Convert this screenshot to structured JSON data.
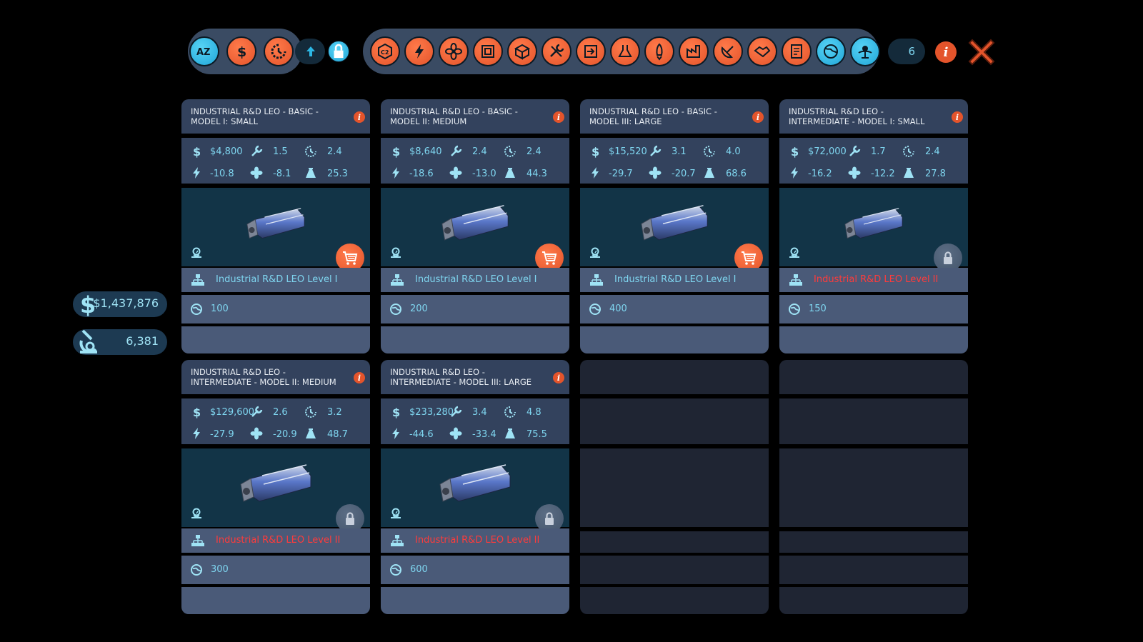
{
  "toolbar": {
    "sort_buttons": [
      "az-sort-icon",
      "dollar-icon",
      "build-time-icon"
    ],
    "sort_direction_icon": "arrow-up-icon",
    "lock_filter_icon": "lock-icon",
    "categories": [
      "co2-icon",
      "power-icon",
      "fan-icon",
      "habitat-icon",
      "storage-icon",
      "tools-icon",
      "docking-icon",
      "lab-icon",
      "thruster-icon",
      "factory-icon",
      "dish-icon",
      "handshake-icon",
      "document-icon",
      "globe-icon",
      "research-leo-icon"
    ],
    "result_count": "6",
    "info_icon": "info-icon",
    "close_icon": "close-icon"
  },
  "funds": {
    "money": "$1,437,876",
    "research": "6,381"
  },
  "colors": {
    "accent_orange": "#e4542b",
    "accent_blue": "#2cb7e4",
    "locked_red": "#ff3b3b"
  },
  "cards": [
    {
      "title": "INDUSTRIAL R&D LEO - BASIC - MODEL I: SMALL",
      "price": "$4,800",
      "build": "1.5",
      "time": "2.4",
      "power": "-10.8",
      "cooling": "-8.1",
      "mass": "25.3",
      "requirement": "Industrial R&D LEO Level I",
      "req_met": true,
      "research": "100",
      "action": "buy"
    },
    {
      "title": "INDUSTRIAL R&D LEO - BASIC - MODEL II: MEDIUM",
      "price": "$8,640",
      "build": "2.4",
      "time": "2.4",
      "power": "-18.6",
      "cooling": "-13.0",
      "mass": "44.3",
      "requirement": "Industrial R&D LEO Level I",
      "req_met": true,
      "research": "200",
      "action": "buy"
    },
    {
      "title": "INDUSTRIAL R&D LEO - BASIC - MODEL III: LARGE",
      "price": "$15,520",
      "build": "3.1",
      "time": "4.0",
      "power": "-29.7",
      "cooling": "-20.7",
      "mass": "68.6",
      "requirement": "Industrial R&D LEO Level I",
      "req_met": true,
      "research": "400",
      "action": "buy"
    },
    {
      "title": "INDUSTRIAL R&D LEO - INTERMEDIATE - MODEL I: SMALL",
      "price": "$72,000",
      "build": "1.7",
      "time": "2.4",
      "power": "-16.2",
      "cooling": "-12.2",
      "mass": "27.8",
      "requirement": "Industrial R&D LEO Level II",
      "req_met": false,
      "research": "150",
      "action": "lock"
    },
    {
      "title": "INDUSTRIAL R&D LEO - INTERMEDIATE - MODEL II: MEDIUM",
      "price": "$129,600",
      "build": "2.6",
      "time": "3.2",
      "power": "-27.9",
      "cooling": "-20.9",
      "mass": "48.7",
      "requirement": "Industrial R&D LEO Level II",
      "req_met": false,
      "research": "300",
      "action": "lock"
    },
    {
      "title": "INDUSTRIAL R&D LEO - INTERMEDIATE - MODEL III: LARGE",
      "price": "$233,280",
      "build": "3.4",
      "time": "4.8",
      "power": "-44.6",
      "cooling": "-33.4",
      "mass": "75.5",
      "requirement": "Industrial R&D LEO Level II",
      "req_met": false,
      "research": "600",
      "action": "lock"
    }
  ]
}
